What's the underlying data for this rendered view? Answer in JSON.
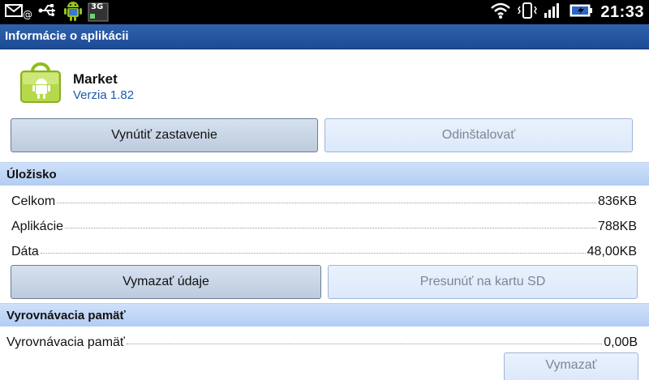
{
  "status_bar": {
    "time": "21:33",
    "network_label": "3G"
  },
  "title_bar": {
    "title": "Informácie o aplikácii"
  },
  "app": {
    "name": "Market",
    "version": "Verzia 1.82"
  },
  "buttons": {
    "force_stop": "Vynútiť zastavenie",
    "uninstall": "Odinštalovať",
    "clear_data": "Vymazať údaje",
    "move_to_sd": "Presunúť na kartu SD",
    "clear_cache": "Vymazať"
  },
  "storage": {
    "header": "Úložisko",
    "rows": [
      {
        "label": "Celkom",
        "value": "836KB"
      },
      {
        "label": "Aplikácie",
        "value": "788KB"
      },
      {
        "label": "Dáta",
        "value": "48,00KB"
      }
    ]
  },
  "cache": {
    "header": "Vyrovnávacia pamäť",
    "rows": [
      {
        "label": "Vyrovnávacia pamäť",
        "value": "0,00B"
      }
    ]
  }
}
